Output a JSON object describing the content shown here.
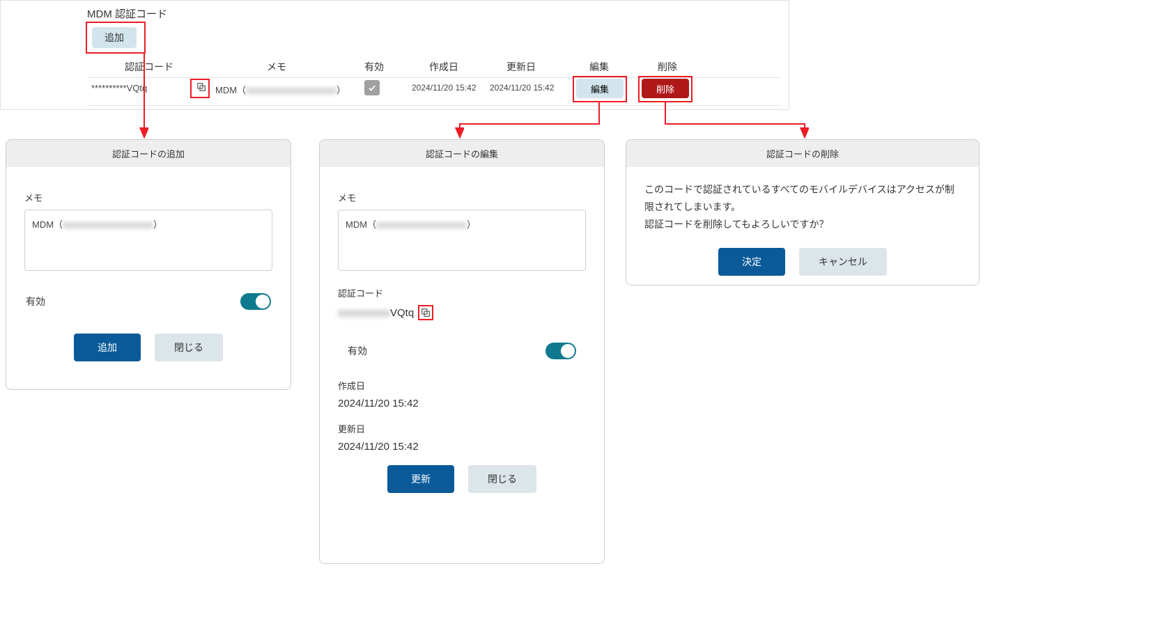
{
  "page": {
    "title": "MDM 認証コード",
    "addLabel": "追加"
  },
  "table": {
    "headers": {
      "code": "認証コード",
      "memo": "メモ",
      "valid": "有効",
      "created": "作成日",
      "updated": "更新日",
      "edit": "編集",
      "delete": "削除"
    },
    "row": {
      "codeMasked": "**********VQtq",
      "memoPrefix": "MDM（",
      "memoBlur": "xxxxxxxxxxxxxxxxxxxx",
      "memoSuffix": "）",
      "created": "2024/11/20 15:42",
      "updated": "2024/11/20 15:42",
      "editLabel": "編集",
      "deleteLabel": "削除"
    }
  },
  "addDialog": {
    "title": "認証コードの追加",
    "memoLabel": "メモ",
    "memoPrefix": "MDM（",
    "memoBlur": "xxxxxxxxxxxxxxxxxxxx",
    "memoSuffix": "）",
    "validLabel": "有効",
    "addBtn": "追加",
    "closeBtn": "閉じる"
  },
  "editDialog": {
    "title": "認証コードの編集",
    "memoLabel": "メモ",
    "memoPrefix": "MDM（",
    "memoBlur": "xxxxxxxxxxxxxxxxxxxx",
    "memoSuffix": "）",
    "codeLabel": "認証コード",
    "codeBlur": "xxxxxxxxxx",
    "codeSuffix": "VQtq",
    "validLabel": "有効",
    "createdLabel": "作成日",
    "createdVal": "2024/11/20 15:42",
    "updatedLabel": "更新日",
    "updatedVal": "2024/11/20 15:42",
    "updateBtn": "更新",
    "closeBtn": "閉じる"
  },
  "deleteDialog": {
    "title": "認証コードの削除",
    "line1": "このコードで認証されているすべてのモバイルデバイスはアクセスが制限されてしまいます。",
    "line2": "認証コードを削除してもよろしいですか？",
    "okBtn": "決定",
    "cancelBtn": "キャンセル"
  }
}
